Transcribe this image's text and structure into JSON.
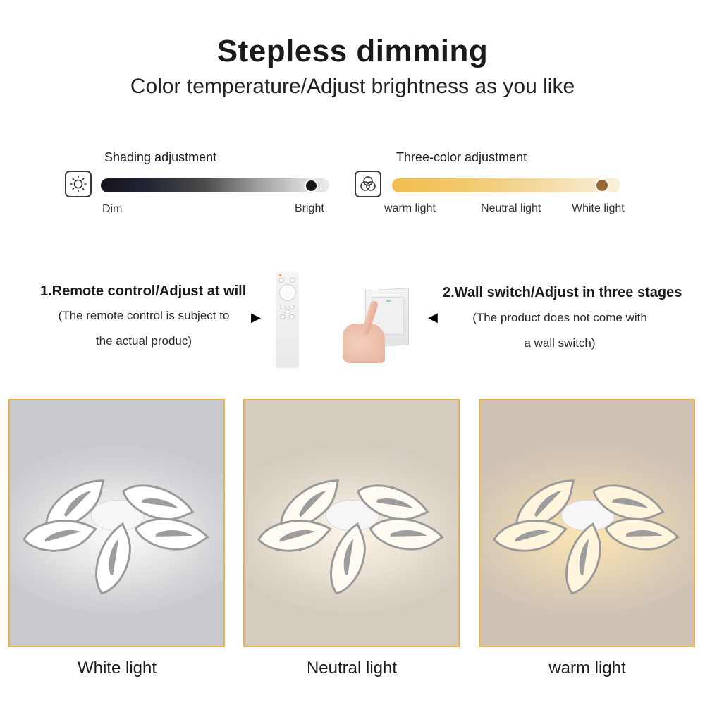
{
  "header": {
    "title": "Stepless dimming",
    "subtitle": "Color temperature/Adjust brightness as you like"
  },
  "shading": {
    "label": "Shading adjustment",
    "icon": "sun-brightness-icon",
    "min_label": "Dim",
    "max_label": "Bright",
    "value_fraction": 0.92
  },
  "three_color": {
    "label": "Three-color adjustment",
    "icon": "three-circles-color-icon",
    "stops": [
      "warm light",
      "Neutral light",
      "White light"
    ],
    "value_fraction": 0.92,
    "colors": {
      "start": "#f1bd4e",
      "end": "#fbefd9",
      "knob": "#9b6a34"
    }
  },
  "controls": {
    "remote": {
      "title": "1.Remote control/Adjust at will",
      "note_line1": "(The remote control is subject to",
      "note_line2": "the actual produc)",
      "arrow": "▶"
    },
    "wall_switch": {
      "title": "2.Wall switch/Adjust in three stages",
      "note_line1": "(The product does not come with",
      "note_line2": "a wall switch)",
      "arrow": "◀"
    }
  },
  "panels": [
    {
      "caption": "White light",
      "wall": "#c9cacd",
      "glow": "#ffffff",
      "leaf": "#ffffff"
    },
    {
      "caption": "Neutral light",
      "wall": "#d4cbbf",
      "glow": "#fff7e8",
      "leaf": "#fffbf2"
    },
    {
      "caption": "warm light",
      "wall": "#cfc3b5",
      "glow": "#ffe7b3",
      "leaf": "#fff4dc"
    }
  ],
  "accent_border": "#e8b24a"
}
